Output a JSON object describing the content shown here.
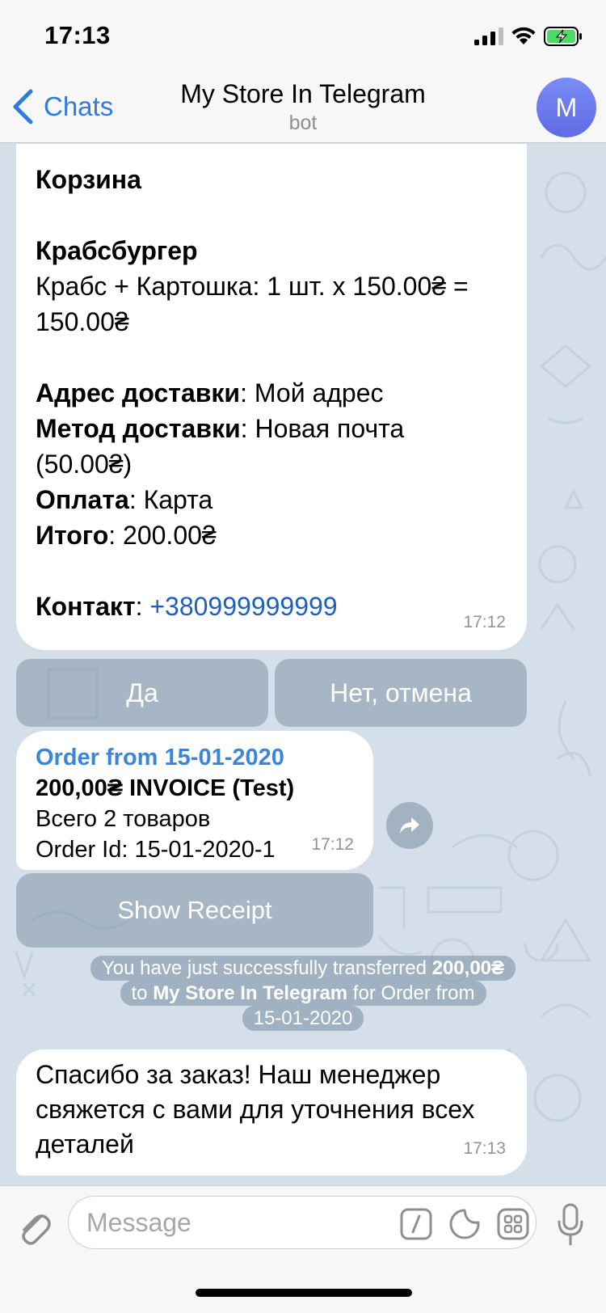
{
  "status_bar": {
    "time": "17:13",
    "icons": [
      "signal-icon",
      "wifi-icon",
      "battery-charging-icon"
    ]
  },
  "nav": {
    "back_label": "Chats",
    "title": "My Store In Telegram",
    "subtitle": "bot",
    "avatar_letter": "M",
    "avatar_color": "#6a78ee",
    "accent_color": "#2f7ce0"
  },
  "cart_message": {
    "heading": "Корзина",
    "product_name": "Крабсбургер",
    "product_line_1": "Крабс + Картошка: 1 шт. x 150.00₴  =",
    "product_line_2": "150.00₴",
    "address_label": "Адрес доставки",
    "address_value": ": Мой адрес",
    "delivery_label": "Метод доставки",
    "delivery_value": ": Новая почта",
    "delivery_price": "(50.00₴)",
    "payment_label": "Оплата",
    "payment_value": ": Карта",
    "total_label": "Итого",
    "total_value": ": 200.00₴",
    "contact_label": "Контакт",
    "contact_sep": ": ",
    "contact_phone": "+380999999999",
    "time": "17:12"
  },
  "inline_keyboard": {
    "yes": "Да",
    "no": "Нет, отмена"
  },
  "invoice_message": {
    "title": "Order from 15-01-2020",
    "amount": "200,00₴ INVOICE (Test)",
    "items": "Всего 2 товаров",
    "order_id": "Order Id: 15-01-2020-1",
    "time": "17:12",
    "receipt_button": "Show Receipt"
  },
  "service_message": {
    "pre": "You have just successfully transferred ",
    "amount": "200,00₴",
    "mid_pre": "to ",
    "bot_name": "My Store In Telegram",
    "mid_post": " for Order from",
    "date": "15-01-2020"
  },
  "thanks_message": {
    "line_1": "Спасибо за заказ! Наш менеджер",
    "line_2": "свяжется с вами для уточнения всех",
    "line_3": "деталей",
    "time": "17:13"
  },
  "input_bar": {
    "placeholder": "Message",
    "icons": [
      "paperclip-icon",
      "bot-command-icon",
      "sticker-icon",
      "bot-keyboard-icon",
      "microphone-icon"
    ]
  }
}
